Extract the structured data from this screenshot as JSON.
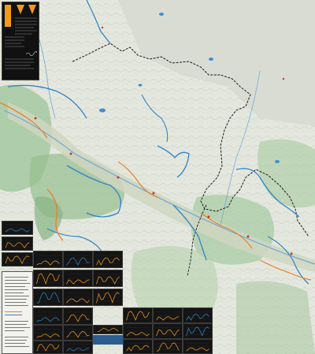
{
  "map": {
    "colors": {
      "terrain": "#dfe3d8",
      "forest": "#8fb98a",
      "valley": "#c9d1b8",
      "route_border": "#222222",
      "route_blue": "#2f84c8",
      "route_orange": "#e8822a",
      "panel_dark": "#141414",
      "accent": "#f39a1d"
    },
    "icons": [
      "trail-badge-icon",
      "elevation-profile-icon",
      "signature-icon"
    ]
  },
  "legend": {
    "title_left": "",
    "title_right": ""
  },
  "profiles": {
    "count": 28
  }
}
